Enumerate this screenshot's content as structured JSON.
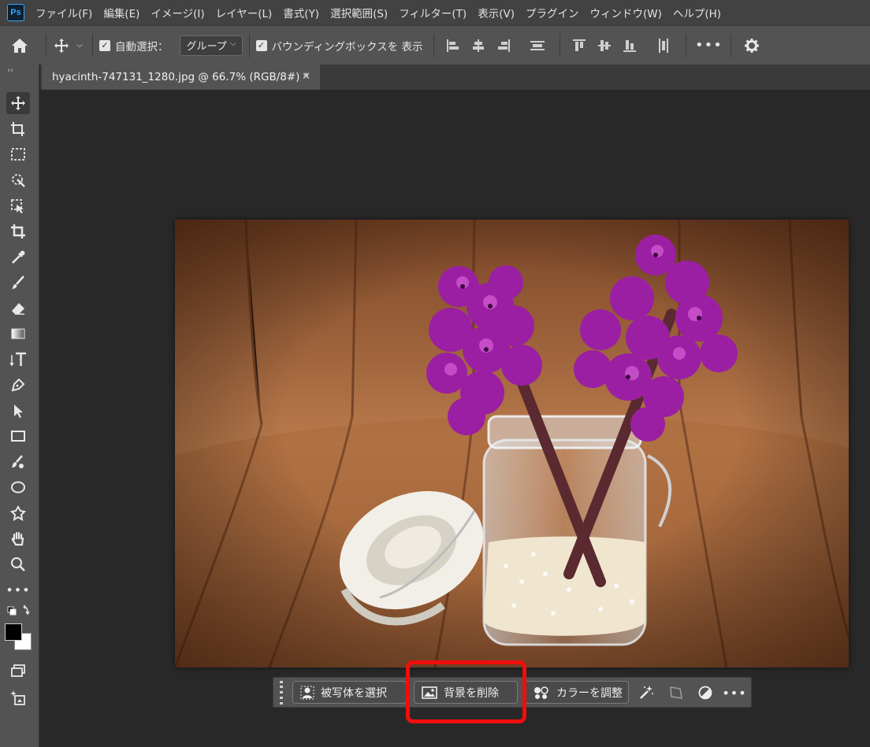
{
  "app": {
    "logo": "Ps"
  },
  "menu": [
    "ファイル(F)",
    "編集(E)",
    "イメージ(I)",
    "レイヤー(L)",
    "書式(Y)",
    "選択範囲(S)",
    "フィルター(T)",
    "表示(V)",
    "プラグイン",
    "ウィンドウ(W)",
    "ヘルプ(H)"
  ],
  "options": {
    "auto_select_label": "自動選択：",
    "auto_select_value": "グループ",
    "bounding_box_label": "バウンディングボックスを 表示"
  },
  "document": {
    "tab_title": "hyacinth-747131_1280.jpg @ 66.7% (RGB/8#) *"
  },
  "taskbar": {
    "select_subject": "被写体を選択",
    "remove_background": "背景を削除",
    "adjust_color": "カラーを調整"
  },
  "colors": {
    "highlight": "#f20d0d",
    "accent": "#31a8ff",
    "foreground": "#000000",
    "background": "#ffffff"
  },
  "icons": [
    "home-icon",
    "move-icon",
    "artboard-icon",
    "marquee-icon",
    "quick-select-icon",
    "frame-icon",
    "crop-icon",
    "eyedropper-icon",
    "brush-icon",
    "eraser-icon",
    "gradient-icon",
    "type-icon",
    "pen-icon",
    "path-select-icon",
    "rectangle-icon",
    "spot-heal-icon",
    "ellipse-icon",
    "puppet-icon",
    "hand-icon",
    "zoom-icon",
    "more-icon",
    "gear-icon"
  ]
}
